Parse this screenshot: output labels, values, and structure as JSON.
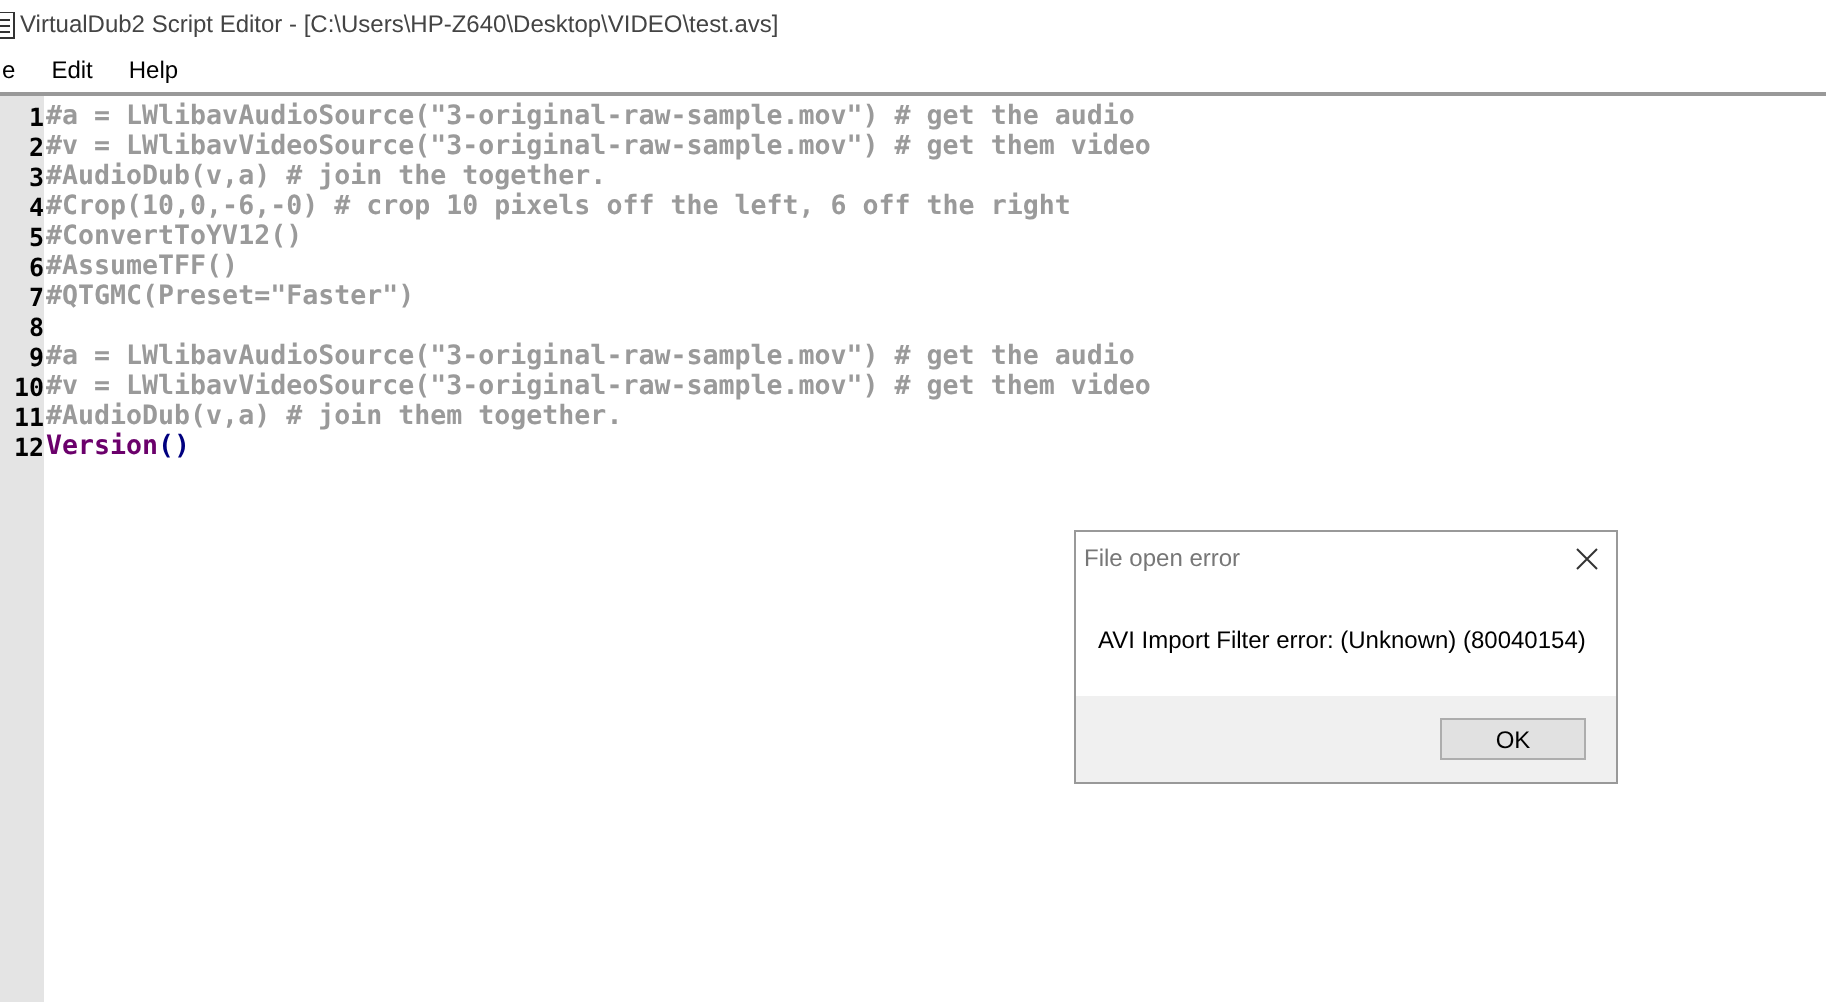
{
  "window": {
    "title": "VirtualDub2 Script Editor - [C:\\Users\\HP-Z640\\Desktop\\VIDEO\\test.avs]"
  },
  "menu": [
    "e",
    "Edit",
    "Help"
  ],
  "editor": {
    "lines": [
      {
        "number": "1",
        "tokens": [
          {
            "kind": "comment",
            "text": "#a = LWlibavAudioSource(\"3-original-raw-sample.mov\") # get the audio"
          }
        ]
      },
      {
        "number": "2",
        "tokens": [
          {
            "kind": "comment",
            "text": "#v = LWlibavVideoSource(\"3-original-raw-sample.mov\") # get them video"
          }
        ]
      },
      {
        "number": "3",
        "tokens": [
          {
            "kind": "comment",
            "text": "#AudioDub(v,a) # join the together."
          }
        ]
      },
      {
        "number": "4",
        "tokens": [
          {
            "kind": "comment",
            "text": "#Crop(10,0,-6,-0) # crop 10 pixels off the left, 6 off the right"
          }
        ]
      },
      {
        "number": "5",
        "tokens": [
          {
            "kind": "comment",
            "text": "#ConvertToYV12()"
          }
        ]
      },
      {
        "number": "6",
        "tokens": [
          {
            "kind": "comment",
            "text": "#AssumeTFF()"
          }
        ]
      },
      {
        "number": "7",
        "tokens": [
          {
            "kind": "comment",
            "text": "#QTGMC(Preset=\"Faster\")"
          }
        ]
      },
      {
        "number": "8"
      },
      {
        "number": "9",
        "tokens": [
          {
            "kind": "comment",
            "text": "#a = LWlibavAudioSource(\"3-original-raw-sample.mov\") # get the audio"
          }
        ]
      },
      {
        "number": "10",
        "tokens": [
          {
            "kind": "comment",
            "text": "#v = LWlibavVideoSource(\"3-original-raw-sample.mov\") # get them video"
          }
        ]
      },
      {
        "number": "11",
        "tokens": [
          {
            "kind": "comment",
            "text": "#AudioDub(v,a) # join them together."
          }
        ]
      },
      {
        "number": "12",
        "tokens": [
          {
            "kind": "keyword",
            "text": "Version"
          },
          {
            "kind": "operator",
            "text": "()"
          }
        ]
      }
    ]
  },
  "dialog": {
    "title": "File open error",
    "message": "AVI Import Filter error: (Unknown) (80040154)",
    "buttons": [
      "OK"
    ]
  }
}
